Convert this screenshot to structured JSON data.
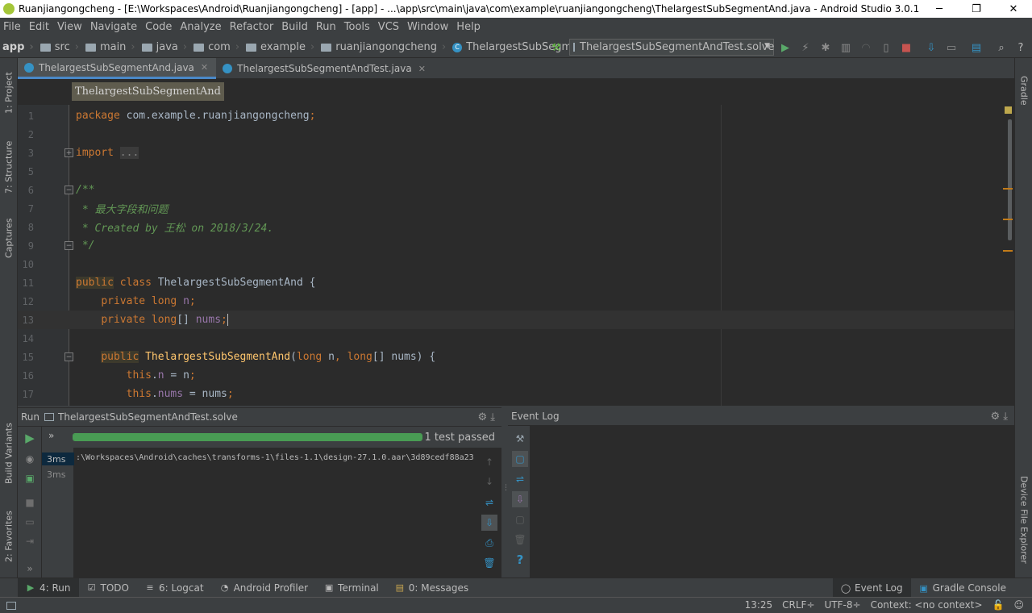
{
  "window": {
    "title": "Ruanjiangongcheng - [E:\\Workspaces\\Android\\Ruanjiangongcheng] - [app] - ...\\app\\src\\main\\java\\com\\example\\ruanjiangongcheng\\ThelargestSubSegmentAnd.java - Android Studio 3.0.1",
    "minimize": "─",
    "restore": "❐",
    "close": "✕"
  },
  "menu": [
    "File",
    "Edit",
    "View",
    "Navigate",
    "Code",
    "Analyze",
    "Refactor",
    "Build",
    "Run",
    "Tools",
    "VCS",
    "Window",
    "Help"
  ],
  "breadcrumbs": [
    "app",
    "src",
    "main",
    "java",
    "com",
    "example",
    "ruanjiangongcheng",
    "ThelargestSubSegmentAnd"
  ],
  "run_config": "ThelargestSubSegmentAndTest.solve",
  "tabs": [
    {
      "label": "ThelargestSubSegmentAnd.java",
      "active": true
    },
    {
      "label": "ThelargestSubSegmentAndTest.java",
      "active": false
    }
  ],
  "editor_breadcrumb": "ThelargestSubSegmentAnd",
  "code_lines": [
    {
      "n": "1",
      "text": "package com.example.ruanjiangongcheng;"
    },
    {
      "n": "2",
      "text": ""
    },
    {
      "n": "3",
      "text": "import ..."
    },
    {
      "n": "4",
      "text": ""
    },
    {
      "n": "5",
      "text": ""
    },
    {
      "n": "6",
      "text": "/**"
    },
    {
      "n": "7",
      "text": " * 最大字段和问题"
    },
    {
      "n": "8",
      "text": " * Created by 王松 on 2018/3/24."
    },
    {
      "n": "9",
      "text": " */"
    },
    {
      "n": "10",
      "text": ""
    },
    {
      "n": "11",
      "text": "public class ThelargestSubSegmentAnd {"
    },
    {
      "n": "12",
      "text": "    private long n;"
    },
    {
      "n": "13",
      "text": "    private long[] nums;"
    },
    {
      "n": "14",
      "text": ""
    },
    {
      "n": "15",
      "text": "    public ThelargestSubSegmentAnd(long n, long[] nums) {"
    },
    {
      "n": "16",
      "text": "        this.n = n;"
    },
    {
      "n": "17",
      "text": "        this.nums = nums;"
    }
  ],
  "left_tools": [
    "1: Project",
    "7: Structure",
    "Captures",
    "Build Variants",
    "2: Favorites"
  ],
  "right_tools": [
    "Gradle",
    "Device File Explorer"
  ],
  "run_panel": {
    "label": "Run",
    "config": "ThelargestSubSegmentAndTest.solve",
    "test_status": "1 test passed",
    "progress": 1.0,
    "durations": [
      "3ms",
      "3ms"
    ],
    "output": ":\\Workspaces\\Android\\caches\\transforms-1\\files-1.1\\design-27.1.0.aar\\3d89cedf88a23"
  },
  "event_log": {
    "label": "Event Log"
  },
  "bottom_tabs": [
    {
      "label": "4: Run",
      "icon": "▶"
    },
    {
      "label": "TODO",
      "icon": "☑"
    },
    {
      "label": "6: Logcat",
      "icon": "≡"
    },
    {
      "label": "Android Profiler",
      "icon": "◔"
    },
    {
      "label": "Terminal",
      "icon": "▣"
    },
    {
      "label": "0: Messages",
      "icon": "▤"
    }
  ],
  "bottom_right_tabs": [
    {
      "label": "Event Log",
      "icon": "◯"
    },
    {
      "label": "Gradle Console",
      "icon": "▣"
    }
  ],
  "status": {
    "position": "13:25",
    "line_sep": "CRLF÷",
    "encoding": "UTF-8÷",
    "context": "Context: <no context>"
  },
  "colors": {
    "accent": "#4a88c7",
    "progress": "#499c54",
    "bg": "#3c3f41",
    "editor_bg": "#2b2b2b"
  }
}
